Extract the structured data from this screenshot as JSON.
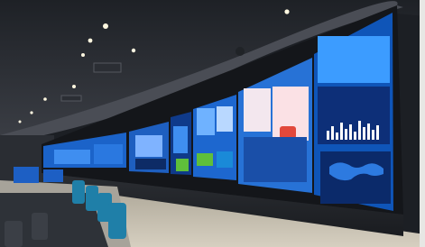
{
  "scene": {
    "subject": "operations-control-room",
    "colors": {
      "ceiling": "#2a2d33",
      "ceiling_light": "#3a3d44",
      "wall_frame": "#14161a",
      "screen_blue": "#1456b8",
      "screen_dark": "#0b2a6a",
      "floor": "#c9c2b4",
      "desk": "#3b3f46",
      "chair_blue": "#1f7fa8",
      "accent_red": "#e2483b",
      "accent_green": "#5fbf3a"
    },
    "lights_count": 9
  }
}
